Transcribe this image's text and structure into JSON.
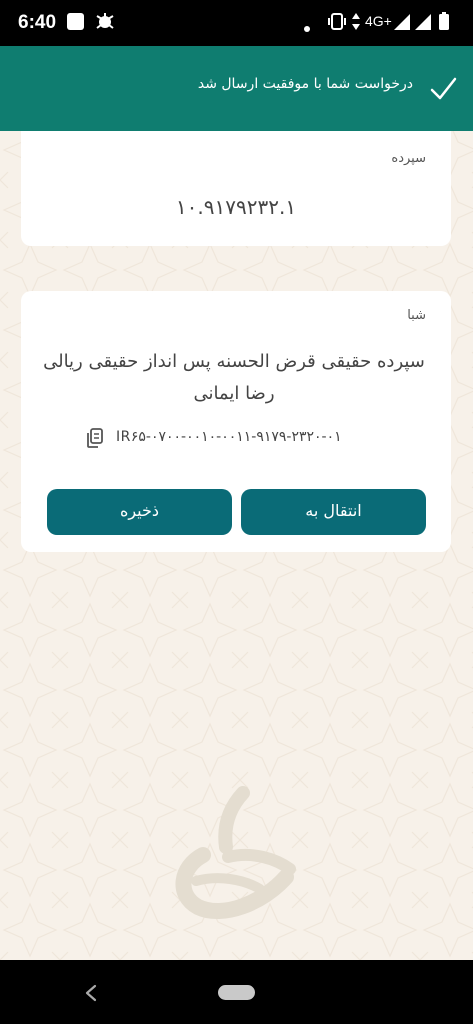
{
  "status_bar": {
    "time": "6:40",
    "network": "4G+",
    "icons": [
      "app-square-icon",
      "settings-bug-icon",
      "dot-icon",
      "vibrate-icon",
      "data-arrows-icon",
      "signal-icon",
      "signal-icon",
      "battery-icon"
    ]
  },
  "banner": {
    "message": "درخواست شما با موفقیت ارسال شد",
    "icon": "check-icon"
  },
  "deposit_card": {
    "label": "سپرده",
    "number": "۱۰.۹۱۷۹۲۳۲.۱"
  },
  "sheba_card": {
    "label": "شبا",
    "title": "سپرده حقیقی قرض الحسنه پس انداز حقیقی ریالی رضا ایمانی",
    "iban": "IR۶۵-۰۷۰۰-۰۰۱۰-۰۰۱۱-۹۱۷۹-۲۳۲۰-۰۱",
    "copy_icon": "copy-icon",
    "transfer_label": "انتقال به",
    "save_label": "ذخیره"
  },
  "colors": {
    "banner": "#0f7d70",
    "button": "#0a6b77",
    "background": "#f7f1e9"
  },
  "nav_bar": {
    "icons": [
      "back-icon",
      "home-pill"
    ]
  }
}
